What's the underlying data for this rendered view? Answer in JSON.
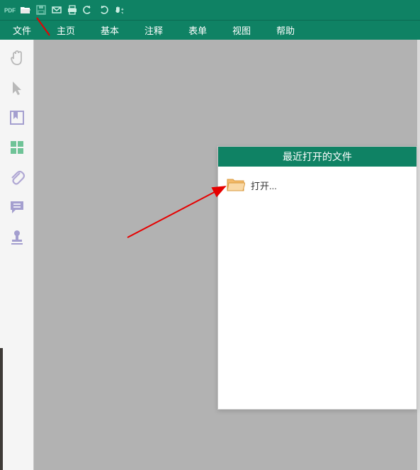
{
  "toolbar": {
    "pdf_label": "PDF",
    "icons": [
      "open-folder",
      "save",
      "mail",
      "print",
      "undo",
      "redo",
      "hand-select"
    ]
  },
  "menu": {
    "items": [
      "文件",
      "主页",
      "基本",
      "注释",
      "表单",
      "视图",
      "帮助"
    ]
  },
  "sidebar": {
    "icons": [
      "hand-tool",
      "select-tool",
      "bookmark-tool",
      "thumbnails-tool",
      "attachment-tool",
      "comments-tool",
      "stamp-tool"
    ]
  },
  "panel": {
    "title": "最近打开的文件",
    "open_label": "打开..."
  }
}
